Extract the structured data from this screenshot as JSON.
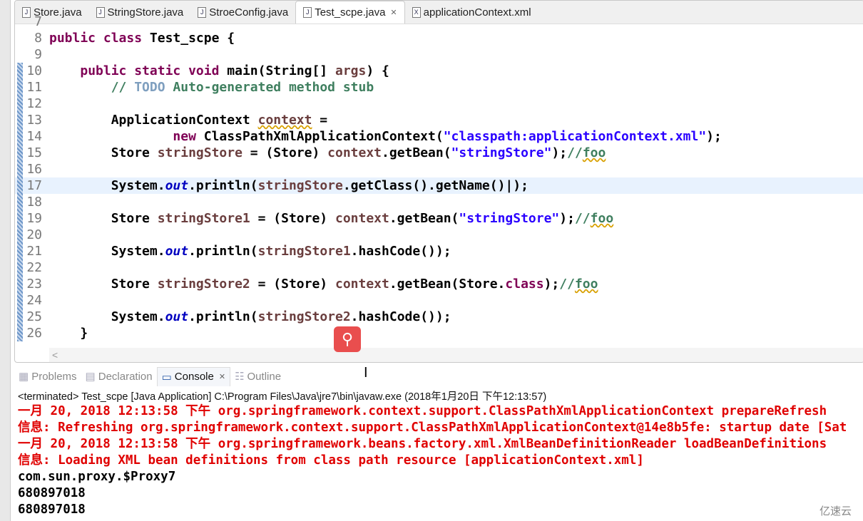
{
  "tabs": [
    {
      "label": "Store.java",
      "icon": "J"
    },
    {
      "label": "StringStore.java",
      "icon": "J"
    },
    {
      "label": "StroeConfig.java",
      "icon": "J"
    },
    {
      "label": "Test_scpe.java",
      "icon": "J",
      "active": true
    },
    {
      "label": "applicationContext.xml",
      "icon": "X"
    }
  ],
  "code_lines": [
    {
      "n": "7",
      "tokens": []
    },
    {
      "n": "8",
      "tokens": [
        [
          "kw",
          "public class "
        ],
        [
          "",
          "Test_scpe {"
        ]
      ]
    },
    {
      "n": "9",
      "tokens": []
    },
    {
      "n": "10",
      "tokens": [
        [
          "",
          "    "
        ],
        [
          "kw",
          "public static void "
        ],
        [
          "",
          "main(String[] "
        ],
        [
          "lv",
          "args"
        ],
        [
          "",
          ") {"
        ]
      ]
    },
    {
      "n": "11",
      "tokens": [
        [
          "",
          "        "
        ],
        [
          "cm",
          "// "
        ],
        [
          "todo",
          "TODO"
        ],
        [
          "cm",
          " Auto-generated method stub"
        ]
      ]
    },
    {
      "n": "12",
      "tokens": []
    },
    {
      "n": "13",
      "tokens": [
        [
          "",
          "        ApplicationContext "
        ],
        [
          "lv warn",
          "context"
        ],
        [
          "",
          " ="
        ]
      ]
    },
    {
      "n": "14",
      "tokens": [
        [
          "",
          "                "
        ],
        [
          "kw",
          "new "
        ],
        [
          "",
          "ClassPathXmlApplicationContext("
        ],
        [
          "str",
          "\"classpath:applicationContext.xml\""
        ],
        [
          "",
          ");"
        ]
      ]
    },
    {
      "n": "15",
      "tokens": [
        [
          "",
          "        Store "
        ],
        [
          "lv",
          "stringStore"
        ],
        [
          "",
          " = (Store) "
        ],
        [
          "lv",
          "context"
        ],
        [
          "",
          ".getBean("
        ],
        [
          "str",
          "\"stringStore\""
        ],
        [
          "",
          ");"
        ],
        [
          "cm",
          "//"
        ],
        [
          "cm warn",
          "foo"
        ]
      ]
    },
    {
      "n": "16",
      "tokens": []
    },
    {
      "n": "17",
      "current": true,
      "tokens": [
        [
          "",
          "        System."
        ],
        [
          "fld",
          "out"
        ],
        [
          "",
          ".println("
        ],
        [
          "lv",
          "stringStore"
        ],
        [
          "",
          ".getClass().getName()|);"
        ]
      ]
    },
    {
      "n": "18",
      "tokens": []
    },
    {
      "n": "19",
      "tokens": [
        [
          "",
          "        Store "
        ],
        [
          "lv",
          "stringStore1"
        ],
        [
          "",
          " = (Store) "
        ],
        [
          "lv",
          "context"
        ],
        [
          "",
          ".getBean("
        ],
        [
          "str",
          "\"stringStore\""
        ],
        [
          "",
          ");"
        ],
        [
          "cm",
          "//"
        ],
        [
          "cm warn",
          "foo"
        ]
      ]
    },
    {
      "n": "20",
      "tokens": []
    },
    {
      "n": "21",
      "tokens": [
        [
          "",
          "        System."
        ],
        [
          "fld",
          "out"
        ],
        [
          "",
          ".println("
        ],
        [
          "lv",
          "stringStore1"
        ],
        [
          "",
          ".hashCode());"
        ]
      ]
    },
    {
      "n": "22",
      "tokens": []
    },
    {
      "n": "23",
      "tokens": [
        [
          "",
          "        Store "
        ],
        [
          "lv",
          "stringStore2"
        ],
        [
          "",
          " = (Store) "
        ],
        [
          "lv",
          "context"
        ],
        [
          "",
          ".getBean(Store."
        ],
        [
          "kw",
          "class"
        ],
        [
          "",
          ");"
        ],
        [
          "cm",
          "//"
        ],
        [
          "cm warn",
          "foo"
        ]
      ]
    },
    {
      "n": "24",
      "tokens": []
    },
    {
      "n": "25",
      "tokens": [
        [
          "",
          "        System."
        ],
        [
          "fld",
          "out"
        ],
        [
          "",
          ".println("
        ],
        [
          "lv",
          "stringStore2"
        ],
        [
          "",
          ".hashCode());"
        ]
      ]
    },
    {
      "n": "26",
      "tokens": [
        [
          "",
          "    }"
        ]
      ]
    }
  ],
  "panel_tabs": [
    {
      "label": "Problems",
      "icon": "problems-icon"
    },
    {
      "label": "Declaration",
      "icon": "declaration-icon"
    },
    {
      "label": "Console",
      "icon": "console-icon",
      "active": true
    },
    {
      "label": "Outline",
      "icon": "outline-icon"
    }
  ],
  "console_status": "<terminated> Test_scpe [Java Application] C:\\Program Files\\Java\\jre7\\bin\\javaw.exe (2018年1月20日 下午12:13:57)",
  "console_lines": [
    {
      "type": "err",
      "text": "一月 20, 2018 12:13:58 下午 org.springframework.context.support.ClassPathXmlApplicationContext prepareRefresh"
    },
    {
      "type": "err",
      "text": "信息: Refreshing org.springframework.context.support.ClassPathXmlApplicationContext@14e8b5fe: startup date [Sat"
    },
    {
      "type": "err",
      "text": "一月 20, 2018 12:13:58 下午 org.springframework.beans.factory.xml.XmlBeanDefinitionReader loadBeanDefinitions"
    },
    {
      "type": "err",
      "text": "信息: Loading XML bean definitions from class path resource [applicationContext.xml]"
    },
    {
      "type": "out",
      "text": "com.sun.proxy.$Proxy7"
    },
    {
      "type": "out",
      "text": "680897018"
    },
    {
      "type": "out",
      "text": "680897018"
    }
  ],
  "watermark": "亿速云"
}
